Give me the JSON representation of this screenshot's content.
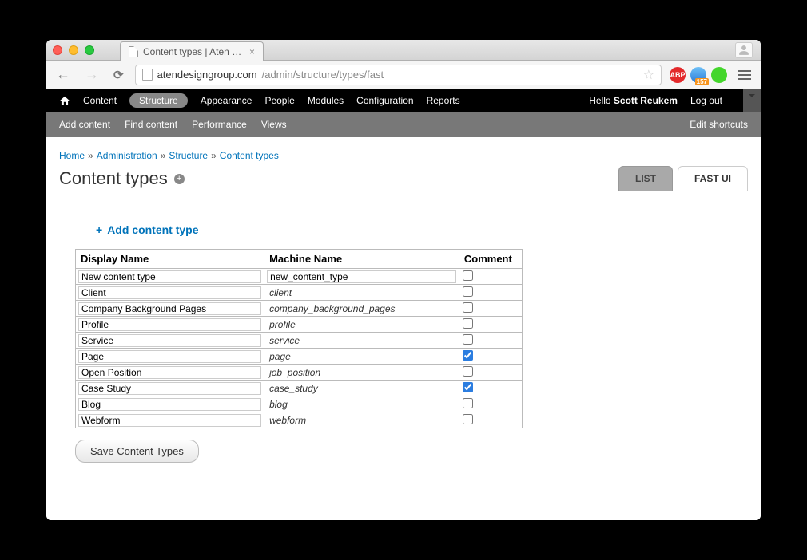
{
  "window": {
    "tab_title": "Content types | Aten Desig",
    "user_icon": "user-icon"
  },
  "browser": {
    "host": "atendesigngroup.com",
    "path": "/admin/structure/types/fast",
    "ext_abp": "ABP",
    "ext_globe_badge": "157",
    "hamburger": "menu"
  },
  "admin_menu": {
    "items": [
      "Content",
      "Structure",
      "Appearance",
      "People",
      "Modules",
      "Configuration",
      "Reports"
    ],
    "active": 1,
    "hello_prefix": "Hello ",
    "hello_name": "Scott Reukem",
    "logout": "Log out"
  },
  "shortcuts": {
    "items": [
      "Add content",
      "Find content",
      "Performance",
      "Views"
    ],
    "edit": "Edit shortcuts"
  },
  "breadcrumbs": [
    {
      "label": "Home"
    },
    {
      "label": "Administration"
    },
    {
      "label": "Structure"
    },
    {
      "label": "Content types"
    }
  ],
  "page_title": "Content types",
  "view_tabs": {
    "list": "LIST",
    "fast": "FAST UI"
  },
  "add_link": "Add content type",
  "table": {
    "headers": {
      "display": "Display Name",
      "machine": "Machine Name",
      "comment": "Comment"
    },
    "new_row": {
      "display": "New content type",
      "machine": "new_content_type",
      "comment": false
    },
    "rows": [
      {
        "display": "Client",
        "machine": "client",
        "comment": false
      },
      {
        "display": "Company Background Pages",
        "machine": "company_background_pages",
        "comment": false
      },
      {
        "display": "Profile",
        "machine": "profile",
        "comment": false
      },
      {
        "display": "Service",
        "machine": "service",
        "comment": false
      },
      {
        "display": "Page",
        "machine": "page",
        "comment": true
      },
      {
        "display": "Open Position",
        "machine": "job_position",
        "comment": false
      },
      {
        "display": "Case Study",
        "machine": "case_study",
        "comment": true
      },
      {
        "display": "Blog",
        "machine": "blog",
        "comment": false
      },
      {
        "display": "Webform",
        "machine": "webform",
        "comment": false
      }
    ]
  },
  "save_button": "Save Content Types"
}
